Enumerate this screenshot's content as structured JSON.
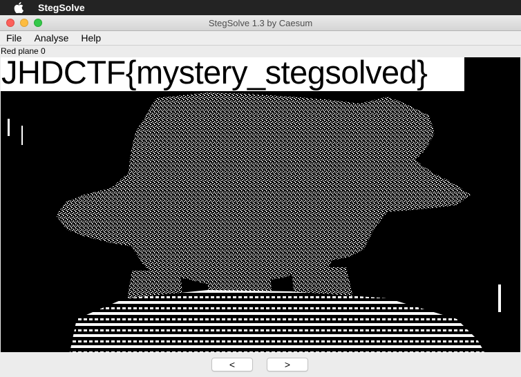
{
  "os_menubar": {
    "app_name": "StegSolve",
    "icon": "apple-icon"
  },
  "window": {
    "title": "StegSolve 1.3 by Caesum"
  },
  "menu": {
    "items": [
      "File",
      "Analyse",
      "Help"
    ]
  },
  "view": {
    "plane_label": "Red plane 0",
    "flag_text": "JHDCTF{mystery_stegsolved}"
  },
  "nav": {
    "prev_label": "<",
    "next_label": ">"
  },
  "colors": {
    "menubar_bg": "#232323",
    "window_bg": "#ececec",
    "image_bg": "#000000"
  }
}
